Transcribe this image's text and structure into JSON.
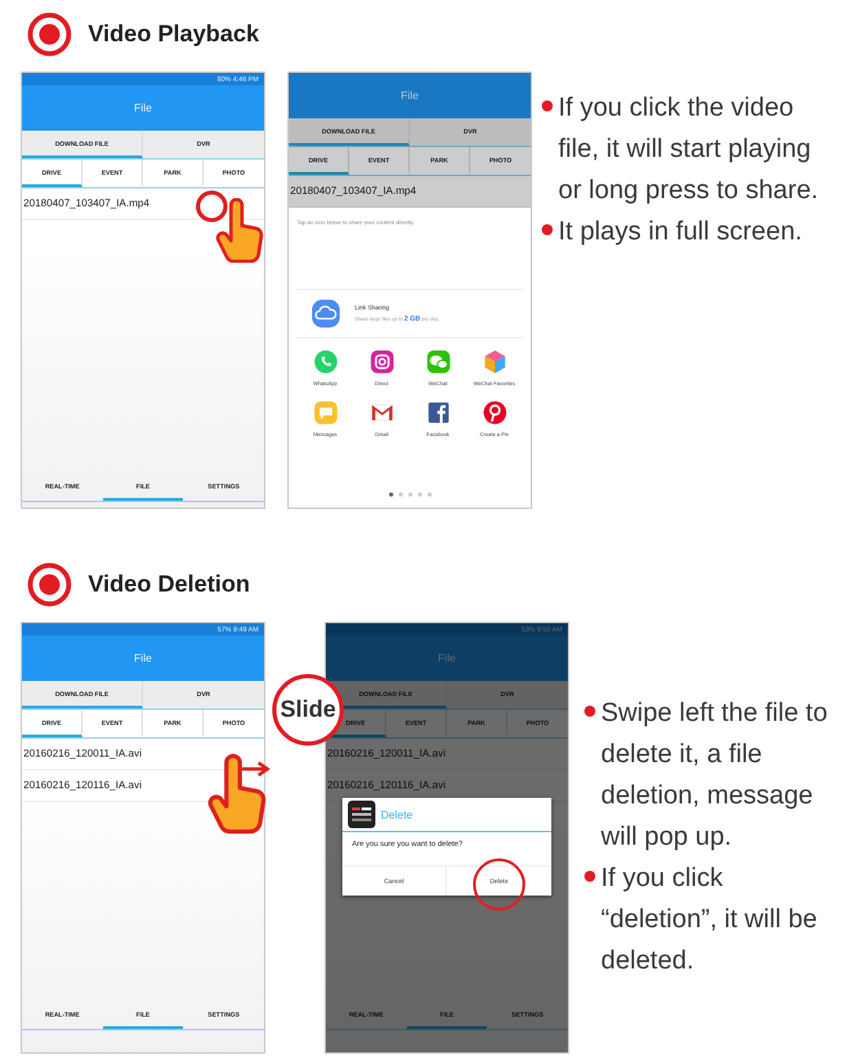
{
  "sections": [
    {
      "title": "Video Playback",
      "phones": [
        {
          "status_text": "80% 4:46 PM",
          "app_title": "File",
          "top_tabs": [
            {
              "label": "DOWNLOAD FILE",
              "selected": true
            },
            {
              "label": "DVR",
              "selected": false
            }
          ],
          "sub_tabs": [
            {
              "label": "DRIVE",
              "selected": true
            },
            {
              "label": "EVENT",
              "selected": false
            },
            {
              "label": "PARK",
              "selected": false
            },
            {
              "label": "PHOTO",
              "selected": false
            }
          ],
          "files": [
            "20180407_103407_IA.mp4"
          ],
          "bottom_tabs": [
            {
              "label": "REAL-TIME",
              "selected": false
            },
            {
              "label": "FILE",
              "selected": true
            },
            {
              "label": "SETTINGS",
              "selected": false
            }
          ],
          "gesture": {
            "kind": "tap"
          }
        },
        {
          "app_title": "File",
          "top_tabs": [
            {
              "label": "DOWNLOAD FILE",
              "selected": true
            },
            {
              "label": "DVR",
              "selected": false
            }
          ],
          "sub_tabs": [
            {
              "label": "DRIVE",
              "selected": true
            },
            {
              "label": "EVENT",
              "selected": false
            },
            {
              "label": "PARK",
              "selected": false
            },
            {
              "label": "PHOTO",
              "selected": false
            }
          ],
          "files": [
            "20180407_103407_IA.mp4"
          ],
          "overlay": {
            "kind": "share_sheet",
            "hint": "Tap an icon below to share your content directly.",
            "link_title": "Link Sharing",
            "link_subtitle": "Share large files up to **2 GB** per day.",
            "apps": [
              {
                "label": "WhatsApp",
                "kind": "phone",
                "color": "#25d366"
              },
              {
                "label": "Direct",
                "kind": "camera",
                "color": "#d6249f"
              },
              {
                "label": "WeChat",
                "kind": "chat",
                "color": "#2dc100"
              },
              {
                "label": "WeChat Favorites",
                "kind": "cube",
                "color": "#f5a623"
              },
              {
                "label": "Messages",
                "kind": "message",
                "color": "#fbc02d"
              },
              {
                "label": "Gmail",
                "kind": "mail",
                "color": "#d93025"
              },
              {
                "label": "Facebook",
                "kind": "square",
                "color": "#3b5998"
              },
              {
                "label": "Create a Pin",
                "kind": "pin",
                "color": "#e60023"
              }
            ],
            "pages": [
              {
                "selected": true
              },
              {
                "selected": false
              },
              {
                "selected": false
              },
              {
                "selected": false
              },
              {
                "selected": false
              }
            ]
          }
        }
      ],
      "notes": [
        "If you click the video file, it will start playing or long press to share.",
        "It plays in full screen."
      ]
    },
    {
      "title": "Video Deletion",
      "phones": [
        {
          "status_text": "57% 9:49 AM",
          "app_title": "File",
          "top_tabs": [
            {
              "label": "DOWNLOAD FILE",
              "selected": true
            },
            {
              "label": "DVR",
              "selected": false
            }
          ],
          "sub_tabs": [
            {
              "label": "DRIVE",
              "selected": true
            },
            {
              "label": "EVENT",
              "selected": false
            },
            {
              "label": "PARK",
              "selected": false
            },
            {
              "label": "PHOTO",
              "selected": false
            }
          ],
          "files": [
            "20160216_120011_IA.avi",
            "20160216_120116_IA.avi"
          ],
          "bottom_tabs": [
            {
              "label": "REAL-TIME",
              "selected": false
            },
            {
              "label": "FILE",
              "selected": true
            },
            {
              "label": "SETTINGS",
              "selected": false
            }
          ],
          "gesture": {
            "kind": "swipe"
          }
        },
        {
          "status_text": "53% 9:50 AM",
          "app_title": "File",
          "top_tabs": [
            {
              "label": "DOWNLOAD FILE",
              "selected": true
            },
            {
              "label": "DVR",
              "selected": false
            }
          ],
          "sub_tabs": [
            {
              "label": "DRIVE",
              "selected": true
            },
            {
              "label": "EVENT",
              "selected": false
            },
            {
              "label": "PARK",
              "selected": false
            },
            {
              "label": "PHOTO",
              "selected": false
            }
          ],
          "files": [
            "20160216_120011_IA.avi",
            "20160216_120116_IA.avi"
          ],
          "bottom_tabs": [
            {
              "label": "REAL-TIME",
              "selected": false
            },
            {
              "label": "FILE",
              "selected": true
            },
            {
              "label": "SETTINGS",
              "selected": false
            }
          ],
          "overlay": {
            "kind": "dialog",
            "title": "Delete",
            "message": "Are you sure you want to delete?",
            "buttons": [
              {
                "label": "Cancel",
                "highlighted": false
              },
              {
                "label": "Delete",
                "highlighted": true
              }
            ]
          }
        }
      ],
      "callout": "Slide",
      "notes": [
        "Swipe left the file to delete it, a file deletion, message will pop up.",
        "If you click “deletion”, it will be deleted."
      ]
    }
  ]
}
